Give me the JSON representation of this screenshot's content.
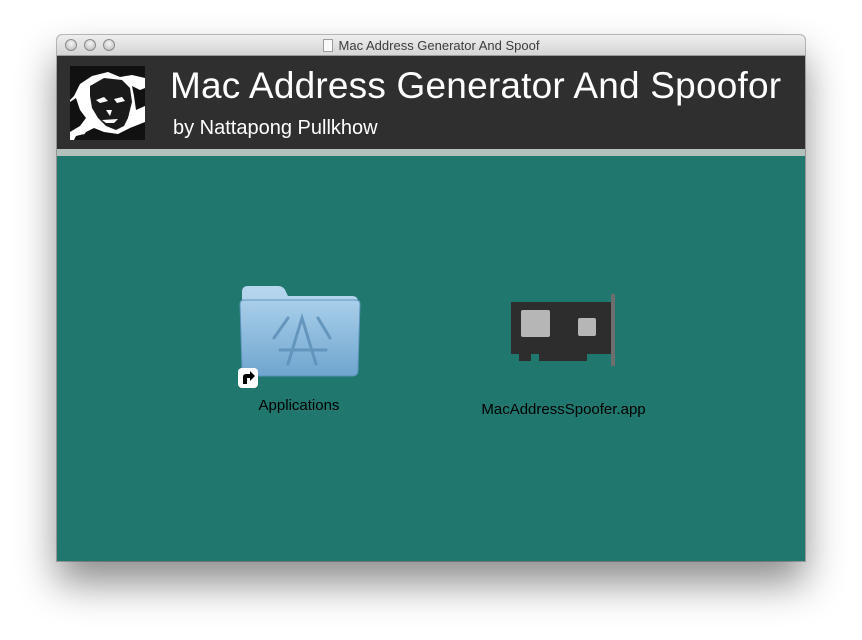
{
  "window": {
    "title": "Mac Address Generator And Spoof"
  },
  "header": {
    "title": "Mac Address Generator And Spoofor",
    "subtitle": "by Nattapong Pullkhow",
    "background": "#2f2f2f"
  },
  "content": {
    "background": "#1f776d",
    "items": [
      {
        "label": "Applications",
        "icon": "applications-folder-alias-icon"
      },
      {
        "label": "MacAddressSpoofer.app",
        "icon": "network-card-icon"
      }
    ]
  }
}
